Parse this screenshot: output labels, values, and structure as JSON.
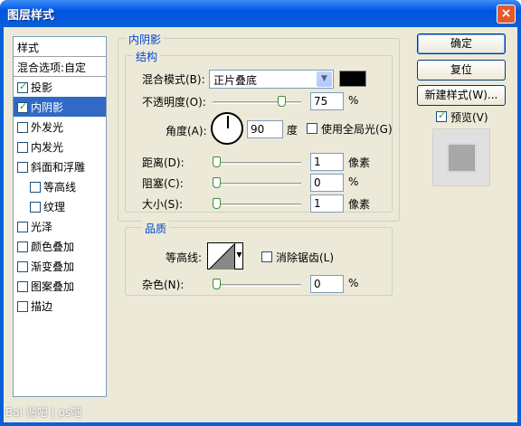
{
  "window": {
    "title": "图层样式",
    "close_symbol": "×"
  },
  "sidebar": {
    "header": "样式",
    "blend_options": "混合选项:自定",
    "items": [
      {
        "label": "投影",
        "checked": true
      },
      {
        "label": "内阴影",
        "checked": true,
        "selected": true
      },
      {
        "label": "外发光",
        "checked": false
      },
      {
        "label": "内发光",
        "checked": false
      },
      {
        "label": "斜面和浮雕",
        "checked": false
      },
      {
        "label": "等高线",
        "checked": false,
        "sub": true
      },
      {
        "label": "纹理",
        "checked": false,
        "sub": true
      },
      {
        "label": "光泽",
        "checked": false
      },
      {
        "label": "颜色叠加",
        "checked": false
      },
      {
        "label": "渐变叠加",
        "checked": false
      },
      {
        "label": "图案叠加",
        "checked": false
      },
      {
        "label": "描边",
        "checked": false
      }
    ]
  },
  "inner_shadow": {
    "section_title": "内阴影",
    "structure": {
      "title": "结构",
      "blend_mode_label": "混合模式(B):",
      "blend_mode_value": "正片叠底",
      "shadow_color": "#000000",
      "opacity_label": "不透明度(O):",
      "opacity_value": "75",
      "opacity_unit": "%",
      "angle_label": "角度(A):",
      "angle_value": "90",
      "angle_unit": "度",
      "global_light_label": "使用全局光(G)",
      "distance_label": "距离(D):",
      "distance_value": "1",
      "distance_unit": "像素",
      "choke_label": "阻塞(C):",
      "choke_value": "0",
      "choke_unit": "%",
      "size_label": "大小(S):",
      "size_value": "1",
      "size_unit": "像素"
    },
    "quality": {
      "title": "品质",
      "contour_label": "等高线:",
      "antialias_label": "消除锯齿(L)",
      "noise_label": "杂色(N):",
      "noise_value": "0",
      "noise_unit": "%"
    }
  },
  "buttons": {
    "ok": "确定",
    "reset": "复位",
    "new_style": "新建样式(W)...",
    "preview_label": "预览(V)"
  },
  "watermark": "Bai 贴吧 | ps吧"
}
